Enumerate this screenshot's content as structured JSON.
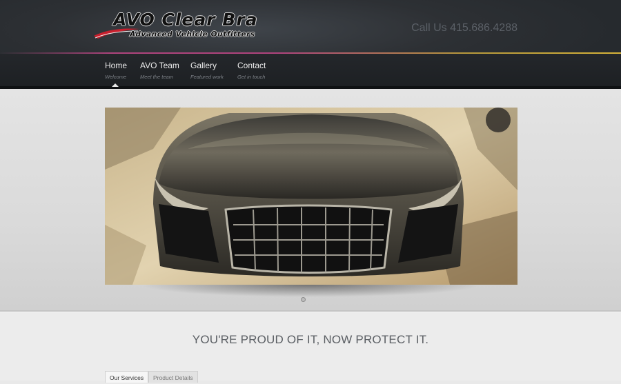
{
  "brand": {
    "logo_title": "AVO Clear Bra",
    "logo_subtitle": "Advanced Vehicle Outfitters",
    "phone": "Call Us 415.686.4288"
  },
  "nav": {
    "items": [
      {
        "label": "Home",
        "sub": "Welcome"
      },
      {
        "label": "AVO Team",
        "sub": "Meet the team"
      },
      {
        "label": "Gallery",
        "sub": "Featured work"
      },
      {
        "label": "Contact",
        "sub": "Get in touch"
      }
    ],
    "active_index": 0
  },
  "hero": {
    "image_icon": "car-front-photo",
    "slide_count": 1,
    "current_slide": 1
  },
  "main": {
    "tagline": "YOU'RE PROUD OF IT, NOW PROTECT IT.",
    "tabs": [
      {
        "label": "Our Services",
        "active": true
      },
      {
        "label": "Product Details",
        "active": false
      }
    ]
  },
  "colors": {
    "header_bg": "#2d3034",
    "accent_pink": "#b0447e",
    "accent_gold": "#d8b43a",
    "logo_red": "#c8202e"
  }
}
